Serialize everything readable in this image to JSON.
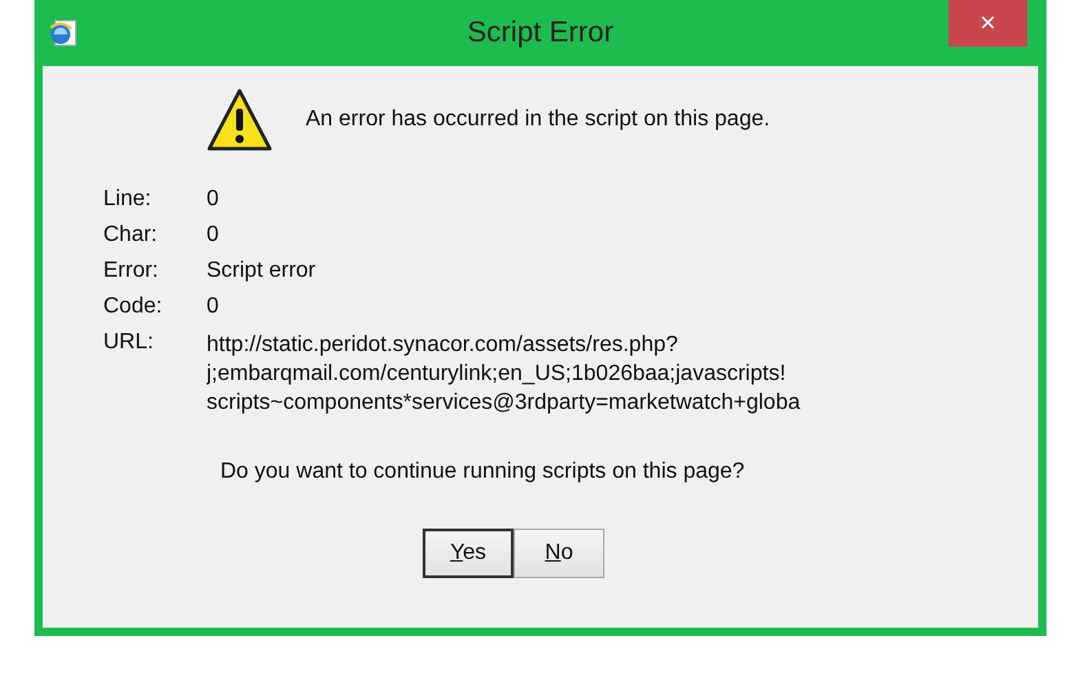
{
  "window": {
    "title": "Script Error",
    "close": "×"
  },
  "message": "An error has occurred in the script on this page.",
  "details": [
    {
      "label": "Line:",
      "value": "0"
    },
    {
      "label": "Char:",
      "value": "0"
    },
    {
      "label": "Error:",
      "value": "Script error"
    },
    {
      "label": "Code:",
      "value": "0"
    }
  ],
  "url": {
    "label": "URL:",
    "lines": [
      "http://static.peridot.synacor.com/assets/res.php?",
      "j;embarqmail.com/centurylink;en_US;1b026baa;javascripts!",
      "scripts~components*services@3rdparty=marketwatch+globa"
    ]
  },
  "question": "Do you want to continue running scripts on this page?",
  "buttons": [
    {
      "access_key": "Y",
      "rest": "es",
      "default": true
    },
    {
      "access_key": "N",
      "rest": "o",
      "default": false
    }
  ]
}
